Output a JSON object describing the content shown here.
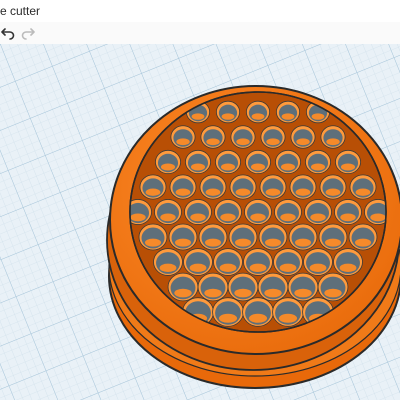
{
  "window": {
    "title_fragment": "e cutter"
  },
  "toolbar": {
    "undo": "undo-icon",
    "redo": "redo-icon"
  },
  "colors": {
    "workplane": "#e9f1f7",
    "grid_minor": "#c9dce8",
    "grid_major": "#a8c6da",
    "cutter_body": "#f07a18",
    "cutter_shadow": "#b84f05",
    "hole_dark": "#5e6f7a",
    "outline": "#2a2a2a"
  }
}
